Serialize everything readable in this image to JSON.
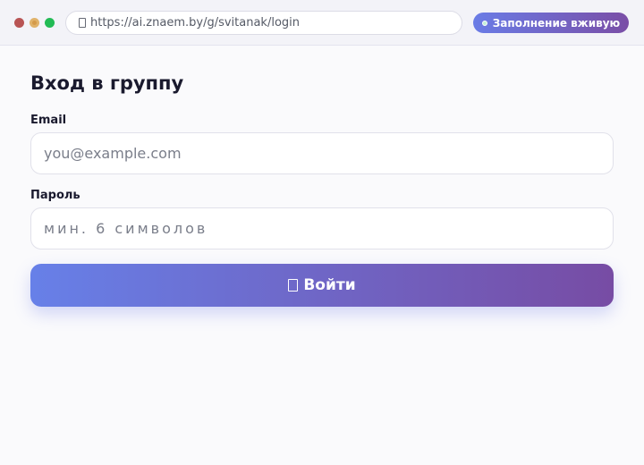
{
  "browser": {
    "url": "https://ai.znaem.by/g/svitanak/login",
    "live_badge": "Заполнение вживую"
  },
  "form": {
    "title": "Вход в группу",
    "email_label": "Email",
    "email_placeholder": "you@example.com",
    "email_value": "",
    "password_label": "Пароль",
    "password_placeholder": "мин. 6 символов",
    "password_value": "",
    "submit_label": "Войти"
  },
  "colors": {
    "accent_start": "#6780e8",
    "accent_end": "#774ca4"
  },
  "icons": {
    "url_bar": "lock-icon",
    "submit": "enter-icon"
  }
}
